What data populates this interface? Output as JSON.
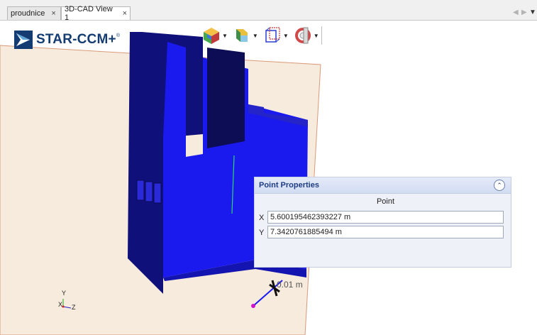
{
  "tabs": [
    {
      "label": "proudnice",
      "close": "×"
    },
    {
      "label": "3D-CAD View 1",
      "close": "×"
    }
  ],
  "tab_nav": {
    "prev": "◀",
    "next": "▶",
    "menu": "▼"
  },
  "logo": {
    "text": "STAR-CCM+",
    "trademark": "®"
  },
  "toolbar": {
    "buttons": [
      {
        "icon": "view-cube-icon"
      },
      {
        "icon": "shape-icon"
      },
      {
        "icon": "bounding-box-icon"
      },
      {
        "icon": "section-icon"
      }
    ],
    "dropdown_glyph": "▼"
  },
  "point_properties": {
    "title": "Point Properties",
    "collapse_glyph": "⌃",
    "column_header": "Point",
    "x_label": "X",
    "x_value": "5.600195462393227 m",
    "y_label": "Y",
    "y_value": "7.3420761885494 m"
  },
  "scale_label": "0.01 m",
  "axes": {
    "y": "Y",
    "x": "X",
    "z": "Z"
  },
  "colors": {
    "model": "#1a1aef",
    "model_dark": "#10106a",
    "plane": "#f6ebdc",
    "plane_border": "#d99a7a",
    "panel_title": "#1f3d82"
  }
}
